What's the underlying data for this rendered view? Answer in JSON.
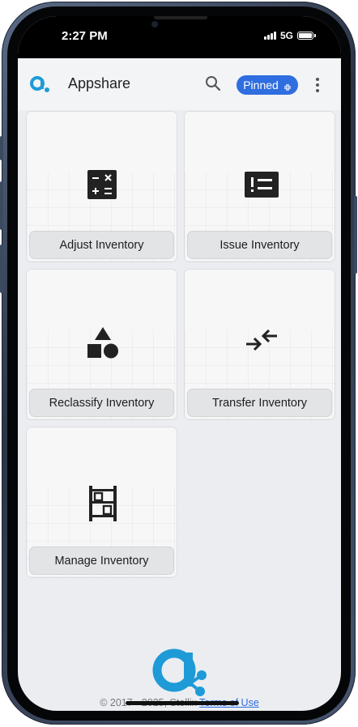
{
  "status_bar": {
    "time": "2:27 PM",
    "network": "5G"
  },
  "app_bar": {
    "title": "Appshare",
    "pinned_label": "Pinned"
  },
  "tiles": [
    {
      "label": "Adjust Inventory",
      "icon": "calculator-icon"
    },
    {
      "label": "Issue Inventory",
      "icon": "list-icon"
    },
    {
      "label": "Reclassify Inventory",
      "icon": "shapes-icon"
    },
    {
      "label": "Transfer Inventory",
      "icon": "transfer-arrows-icon"
    },
    {
      "label": "Manage Inventory",
      "icon": "shelves-icon"
    }
  ],
  "footer": {
    "copyright": "© 2017 - 2025, Stellix",
    "terms_link": "Terms of Use"
  },
  "colors": {
    "accent": "#2f6ee0",
    "logo": "#1e9bd7",
    "background": "#ebedf1"
  }
}
